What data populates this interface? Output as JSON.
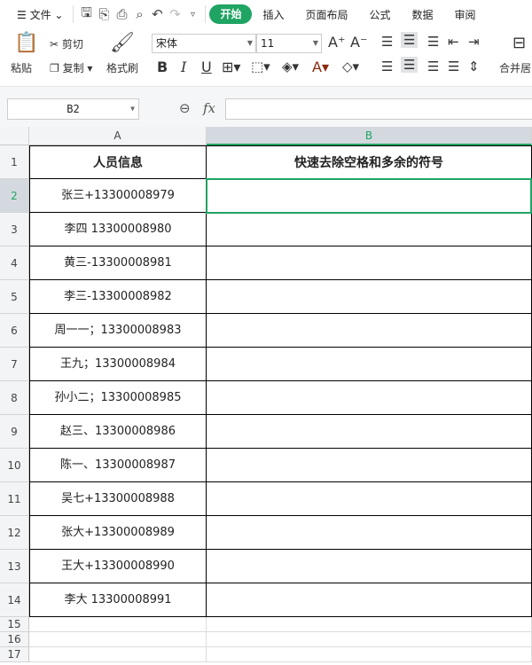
{
  "menubar": {
    "file": "文件",
    "tabs": [
      "开始",
      "插入",
      "页面布局",
      "公式",
      "数据",
      "审阅"
    ]
  },
  "toolbar": {
    "paste": "粘贴",
    "cut": "剪切",
    "copy": "复制",
    "format_painter": "格式刷",
    "font": "宋体",
    "size": "11",
    "merge": "合并居"
  },
  "formula": {
    "cell_ref": "B2",
    "fx": "fx",
    "value": ""
  },
  "columns": [
    "A",
    "B"
  ],
  "rows": [
    "1",
    "2",
    "3",
    "4",
    "5",
    "6",
    "7",
    "8",
    "9",
    "10",
    "11",
    "12",
    "13",
    "14",
    "15",
    "16",
    "17"
  ],
  "table": {
    "header_a": "人员信息",
    "header_b": "快速去除空格和多余的符号",
    "values": [
      "张三+13300008979",
      "李四 13300008980",
      "黄三-13300008981",
      "李三-13300008982",
      "周一一；13300008983",
      "王九；13300008984",
      "孙小二；13300008985",
      "赵三、13300008986",
      "陈一、13300008987",
      "吴七+13300008988",
      "张大+13300008989",
      "王大+13300008990",
      "李大 13300008991"
    ]
  },
  "colors": {
    "accent": "#1fa463"
  }
}
